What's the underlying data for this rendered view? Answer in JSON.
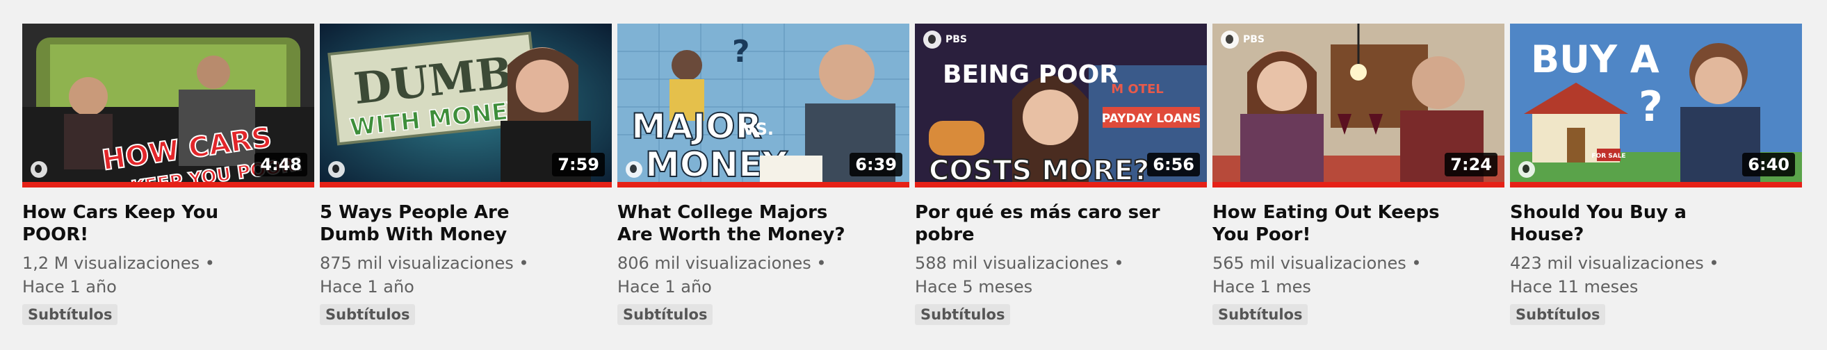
{
  "videos": [
    {
      "title": "How Cars Keep You POOR!",
      "thumb_text": [
        "HOW CARS",
        "KEEP YOU POOR!"
      ],
      "duration": "4:48",
      "views": "1,2 M visualizaciones",
      "age": "Hace 1 año",
      "badge": "Subtítulos"
    },
    {
      "title": "5 Ways People Are Dumb With Money",
      "thumb_text": [
        "DUMB",
        "WITH MONEY"
      ],
      "duration": "7:59",
      "views": "875 mil visualizaciones",
      "age": "Hace 1 año",
      "badge": "Subtítulos"
    },
    {
      "title": "What College Majors Are Worth the Money?",
      "thumb_text": [
        "MAJOR",
        "VS.",
        "MONEY"
      ],
      "duration": "6:39",
      "views": "806 mil visualizaciones",
      "age": "Hace 1 año",
      "badge": "Subtítulos"
    },
    {
      "title": "Por qué es más caro ser pobre",
      "thumb_text": [
        "BEING POOR",
        "COSTS MORE?",
        "PAYDAY LOANS",
        "M OTEL"
      ],
      "pbs_label": "PBS",
      "duration": "6:56",
      "views": "588 mil visualizaciones",
      "age": "Hace 5 meses",
      "badge": "Subtítulos"
    },
    {
      "title": "How Eating Out Keeps You Poor!",
      "pbs_label": "PBS",
      "duration": "7:24",
      "views": "565 mil visualizaciones",
      "age": "Hace 1 mes",
      "badge": "Subtítulos"
    },
    {
      "title": "Should You Buy a House?",
      "thumb_text": [
        "BUY A",
        "?",
        "FOR SALE"
      ],
      "duration": "6:40",
      "views": "423 mil visualizaciones",
      "age": "Hace 11 meses",
      "badge": "Subtítulos"
    }
  ],
  "meta_separator": " •",
  "colors": {
    "progress": "#e62117",
    "background": "#f1f1f1"
  }
}
